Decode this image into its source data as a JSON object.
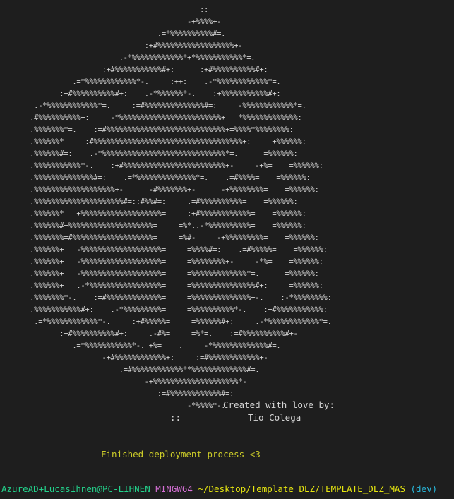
{
  "art_lines": [
    "                                               ::",
    "                                            -+%%%%+-",
    "                                     .=*%%%%%%%%%%#=.",
    "                                  :+#%%%%%%%%%%%%%%%%%%+-",
    "                            .-*%%%%%%%%%%%%*+*%%%%%%%%%%%*=.",
    "                        :+#%%%%%%%%%%%#+:      :+#%%%%%%%%%%#+:",
    "                 .=*%%%%%%%%%%%%*-.     :++:    .-*%%%%%%%%%%%%*=.",
    "              :+#%%%%%%%%%%#+:    .-*%%%%%%*-.    :+%%%%%%%%%%%#+:",
    "        .-*%%%%%%%%%%%%*=.     :=#%%%%%%%%%%%%%%#=:     -%%%%%%%%%%%%*=.",
    "       .#%%%%%%%%%%+:     -*%%%%%%%%%%%%%%%%%%%%%%%%+   *%%%%%%%%%%%%%:",
    "       .%%%%%%%*=.    :=#%%%%%%%%%%%%%%%%%%%%%%%%%%%%+=%%%%*%%%%%%%%:",
    "       .%%%%%%*     :#%%%%%%%%%%%%%%%%%%%%%%%%%%%%%%%%%%%+:     +%%%%%%:",
    "       .%%%%%%#=:    .-*%%%%%%%%%%%%%%%%%%%%%%%%%%%%%*=.      =%%%%%%:",
    "       .%%%%%%%%%%%*-.    :+#%%%%%%%%%%%%%%%%%%%%%%%%+-     -+%=    =%%%%%%:",
    "       .%%%%%%%%%%%%%%#=:    .=*%%%%%%%%%%%%%%*=.    .=#%%%%=    =%%%%%%:",
    "       .%%%%%%%%%%%%%%%%%%%+-      -#%%%%%%%+-      -+%%%%%%%%=    =%%%%%%:",
    "       .%%%%%%%%%%%%%%%%%%%%%#=::#%%#=:     .=#%%%%%%%%%%=    =%%%%%%:",
    "       .%%%%%%*   +%%%%%%%%%%%%%%%%%%%=     :+#%%%%%%%%%%%%=    =%%%%%%:",
    "       .%%%%%%#+%%%%%%%%%%%%%%%%%%%%=     =%*..-*%%%%%%%%%%=    =%%%%%%:",
    "       .%%%%%%%=#%%%%%%%%%%%%%%%%%%%=     =%#-     -+%%%%%%%%%=    =%%%%%%:",
    "       .%%%%%%+   -%%%%%%%%%%%%%%%%%%%=     =%%%%#=:    .=#%%%%%=    =%%%%%%:",
    "       .%%%%%%+   -%%%%%%%%%%%%%%%%%%%=     =%%%%%%%%+-     -*%=    =%%%%%%:",
    "       .%%%%%%+   -%%%%%%%%%%%%%%%%%%%=     =%%%%%%%%%%%%%*=.      =%%%%%%:",
    "       .%%%%%%+   .-*%%%%%%%%%%%%%%%%%=     =%%%%%%%%%%%%%%%#+:     =%%%%%%:",
    "       .%%%%%%%*-.    :=#%%%%%%%%%%%%%=     =%%%%%%%%%%%%%%+-.    :-*%%%%%%%%:",
    "       .%%%%%%%%%%%#+:    .-*%%%%%%%%%=     =%%%%%%%%%%*-.    :+#%%%%%%%%%%%:",
    "        .=*%%%%%%%%%%%%*-.     :+#%%%%%=     =%%%%%%#+:     .-*%%%%%%%%%%%%*=.",
    "              :+#%%%%%%%%%%#+:     .-#%=     =%*=.    :=#%%%%%%%%%%#+-",
    "                 .=*%%%%%%%%%%%*-. +%=    .     -*%%%%%%%%%%%%%#=.",
    "                        -+#%%%%%%%%%%%%+:     :=#%%%%%%%%%%%%+-",
    "                            .=#%%%%%%%%%%%%**%%%%%%%%%%%%%#=.",
    "                                  -+%%%%%%%%%%%%%%%%%%%%*-",
    "                                     :=#%%%%%%%%%%%%#=:",
    "                                            -*%%%%*-."
  ],
  "credits": {
    "line1": "Created with love by:",
    "line2": "Tio Colega"
  },
  "art_tail": "::",
  "banner": {
    "top": "---------------------------------------------------------------------------",
    "mid": "---------------    Finished deployment process <3    ---------------",
    "bot": "---------------------------------------------------------------------------"
  },
  "prompt": {
    "user_host": "AzureAD+LucasIhnen@PC-LIHNEN",
    "env": "MINGW64",
    "path": "~/Desktop/Template DLZ/TEMPLATE_DLZ_MAS",
    "branch": "(dev)"
  },
  "colors": {
    "background": "#1e1e1e",
    "text": "#d4d4d4",
    "banner": "#cccc29",
    "user": "#23d18b",
    "env": "#d670d6",
    "path": "#e5e510",
    "branch": "#29b8db"
  }
}
